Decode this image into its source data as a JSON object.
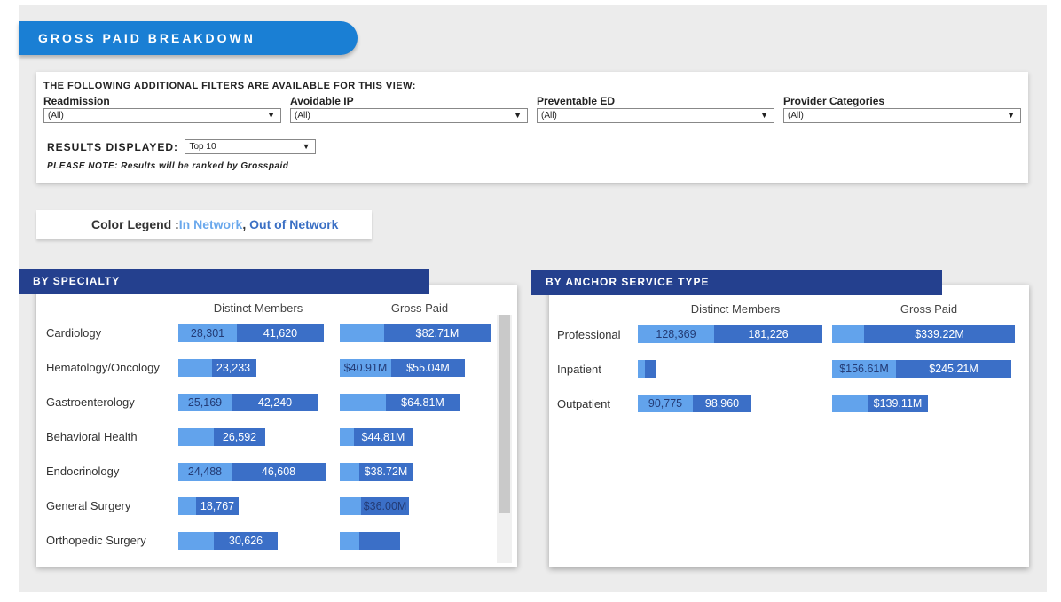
{
  "title": "GROSS PAID BREAKDOWN",
  "filters": {
    "heading": "THE FOLLOWING ADDITIONAL FILTERS ARE AVAILABLE FOR THIS VIEW:",
    "items": [
      {
        "label": "Readmission",
        "value": "(All)"
      },
      {
        "label": "Avoidable IP",
        "value": "(All)"
      },
      {
        "label": "Preventable ED",
        "value": "(All)"
      },
      {
        "label": "Provider Categories",
        "value": "(All)"
      }
    ],
    "results_label": "RESULTS DISPLAYED:",
    "results_value": "Top 10",
    "note": "PLEASE NOTE: Results will be ranked by Grosspaid"
  },
  "legend": {
    "label": "Color Legend :",
    "in_network": "In Network",
    "separator": ", ",
    "out_network": "Out of Network"
  },
  "colors": {
    "in_network": "#62a3ec",
    "out_of_network": "#3b6fc7",
    "header": "#24408e",
    "title_pill": "#1a7fd4"
  },
  "specialty": {
    "header": "BY SPECIALTY",
    "col_members": "Distinct Members",
    "col_paid": "Gross Paid",
    "rows": [
      {
        "name": "Cardiology",
        "members_in": "28,301",
        "members_out": "41,620",
        "paid_in": "",
        "paid_out": "$82.71M"
      },
      {
        "name": "Hematology/Oncology",
        "members_in": "",
        "members_out": "23,233",
        "paid_in": "$40.91M",
        "paid_out": "$55.04M"
      },
      {
        "name": "Gastroenterology",
        "members_in": "25,169",
        "members_out": "42,240",
        "paid_in": "",
        "paid_out": "$64.81M"
      },
      {
        "name": "Behavioral Health",
        "members_in": "",
        "members_out": "26,592",
        "paid_in": "",
        "paid_out": "$44.81M"
      },
      {
        "name": "Endocrinology",
        "members_in": "24,488",
        "members_out": "46,608",
        "paid_in": "",
        "paid_out": "$38.72M"
      },
      {
        "name": "General Surgery",
        "members_in": "",
        "members_out": "18,767",
        "paid_in": "",
        "paid_out": "$36.00M"
      },
      {
        "name": "Orthopedic Surgery",
        "members_in": "",
        "members_out": "30,626",
        "paid_in": "",
        "paid_out": ""
      }
    ]
  },
  "anchor": {
    "header": "BY ANCHOR SERVICE TYPE",
    "col_members": "Distinct Members",
    "col_paid": "Gross Paid",
    "rows": [
      {
        "name": "Professional",
        "members_in": "128,369",
        "members_out": "181,226",
        "paid_in": "",
        "paid_out": "$339.22M"
      },
      {
        "name": "Inpatient",
        "members_in": "",
        "members_out": "",
        "paid_in": "$156.61M",
        "paid_out": "$245.21M"
      },
      {
        "name": "Outpatient",
        "members_in": "90,775",
        "members_out": "98,960",
        "paid_in": "",
        "paid_out": "$139.11M"
      }
    ]
  }
}
